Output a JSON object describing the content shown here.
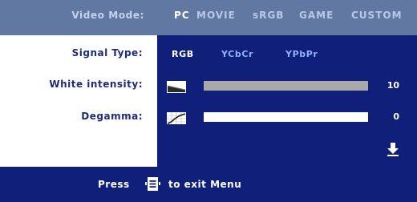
{
  "mode_bar": {
    "label": "Video Mode:",
    "options": [
      {
        "label": "PC",
        "active": true
      },
      {
        "label": "MOVIE",
        "active": false
      },
      {
        "label": "sRGB",
        "active": false
      },
      {
        "label": "GAME",
        "active": false
      },
      {
        "label": "CUSTOM",
        "active": false
      }
    ]
  },
  "signal_type": {
    "label": "Signal Type:",
    "options": [
      {
        "label": "RGB",
        "active": true
      },
      {
        "label": "YCbCr",
        "active": false
      },
      {
        "label": "YPbPr",
        "active": false
      }
    ]
  },
  "white_intensity": {
    "label": "White intensity:",
    "value": "10",
    "level": 1.0,
    "icon": "white-intensity-icon"
  },
  "degamma": {
    "label": "Degamma:",
    "value": "0",
    "level": 0.0,
    "icon": "degamma-curve-icon"
  },
  "scroll": {
    "icon": "scroll-down-icon"
  },
  "footer": {
    "press": "Press",
    "exit": "to exit Menu",
    "menu_icon": "menu-button-icon"
  },
  "colors": {
    "mode_bar_bg": "#6178a3",
    "panel_bg": "#0f1f7a",
    "label_text": "#1f2a78",
    "inactive_option": "#8fb1ff",
    "bar_fill": "#a9a9a9"
  }
}
